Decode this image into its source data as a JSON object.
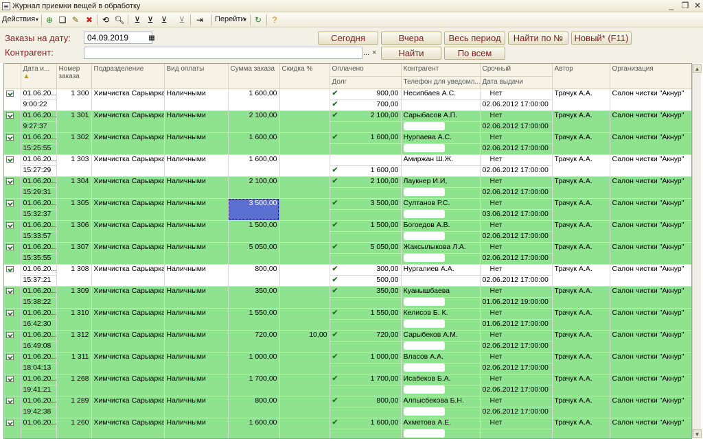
{
  "window": {
    "title": "Журнал приемки вещей в обработку"
  },
  "toolbar": {
    "actions": "Действия",
    "goto": "Перейти"
  },
  "form": {
    "date_label": "Заказы на дату:",
    "date_value": "04.09.2019",
    "contractor_label": "Контрагент:",
    "contractor_value": "",
    "btn_today": "Сегодня",
    "btn_yesterday": "Вчера",
    "btn_all_period": "Весь период",
    "btn_find_no": "Найти по №",
    "btn_new": "Новый* (F11)",
    "btn_find": "Найти",
    "btn_all": "По всем",
    "ellipsis": "...",
    "clear": "×"
  },
  "headers": {
    "date": "Дата и...",
    "number": "Номер заказа",
    "division": "Подразделение",
    "payment": "Вид оплаты",
    "sum": "Сумма заказа",
    "discount": "Скидка %",
    "paid": "Оплачено",
    "debt": "Долг",
    "contractor": "Контрагент",
    "phone": "Телефон для уведомл...",
    "urgent": "Срочный",
    "issue_date": "Дата выдачи",
    "author": "Автор",
    "org": "Организация"
  },
  "rows": [
    {
      "d1": "01.06.20...",
      "d2": "9:00:22",
      "no": "1 300",
      "div": "Химчистка Сарыарка",
      "pay": "Наличными",
      "sum": "1 600,00",
      "disc": "",
      "paid": "900,00",
      "debt": "700,00",
      "cnt": "Несипбаев А.С.",
      "ph": "",
      "urg": "Нет",
      "iss": "02.06.2012 17:00:00",
      "auth": "Трачук А.А.",
      "org": "Салон чистки \"Акнур\"",
      "color": "w",
      "debtcheck": true
    },
    {
      "d1": "01.06.20...",
      "d2": "9:27:37",
      "no": "1 301",
      "div": "Химчистка Сарыарка",
      "pay": "Наличными",
      "sum": "2 100,00",
      "disc": "",
      "paid": "2 100,00",
      "debt": "",
      "cnt": "Сарыбасов А.П.",
      "ph": "",
      "urg": "Нет",
      "iss": "02.06.2012 17:00:00",
      "auth": "Трачук А.А.",
      "org": "Салон чистки \"Акнур\"",
      "color": "g"
    },
    {
      "d1": "01.06.20...",
      "d2": "15:25:55",
      "no": "1 302",
      "div": "Химчистка Сарыарка",
      "pay": "Наличными",
      "sum": "1 600,00",
      "disc": "",
      "paid": "1 600,00",
      "debt": "",
      "cnt": "Нурпаева А.С.",
      "ph": "",
      "urg": "Нет",
      "iss": "02.06.2012 17:00:00",
      "auth": "Трачук А.А.",
      "org": "Салон чистки \"Акнур\"",
      "color": "g"
    },
    {
      "d1": "01.06.20...",
      "d2": "15:27:29",
      "no": "1 303",
      "div": "Химчистка Сарыарка",
      "pay": "Наличными",
      "sum": "1 600,00",
      "disc": "",
      "paid": "",
      "debt": "1 600,00",
      "cnt": "Амиржан Ш.Ж.",
      "ph": "",
      "urg": "Нет",
      "iss": "02.06.2012 17:00:00",
      "auth": "Трачук А.А.",
      "org": "Салон чистки \"Акнур\"",
      "color": "w",
      "debtcheck": true,
      "nopaidcheck": true
    },
    {
      "d1": "01.06.20...",
      "d2": "15:29:31",
      "no": "1 304",
      "div": "Химчистка Сарыарка",
      "pay": "Наличными",
      "sum": "2 100,00",
      "disc": "",
      "paid": "2 100,00",
      "debt": "",
      "cnt": "Лаукнер И.И,",
      "ph": "",
      "urg": "Нет",
      "iss": "02.06.2012 17:00:00",
      "auth": "Трачук А.А.",
      "org": "Салон чистки \"Акнур\"",
      "color": "g"
    },
    {
      "d1": "01.06.20...",
      "d2": "15:32:37",
      "no": "1 305",
      "div": "Химчистка Сарыарка",
      "pay": "Наличными",
      "sum": "3 500,00",
      "disc": "",
      "paid": "3 500,00",
      "debt": "",
      "cnt": "Султанов Р.С.",
      "ph": "",
      "urg": "Нет",
      "iss": "03.06.2012 17:00:00",
      "auth": "Трачук А.А.",
      "org": "Салон чистки \"Акнур\"",
      "color": "g",
      "selected": true
    },
    {
      "d1": "01.06.20...",
      "d2": "15:33:57",
      "no": "1 306",
      "div": "Химчистка Сарыарка",
      "pay": "Наличными",
      "sum": "1 500,00",
      "disc": "",
      "paid": "1 500,00",
      "debt": "",
      "cnt": "Богоедов А.В.",
      "ph": "",
      "urg": "Нет",
      "iss": "02.06.2012 17:00:00",
      "auth": "Трачук А.А.",
      "org": "Салон чистки \"Акнур\"",
      "color": "g"
    },
    {
      "d1": "01.06.20...",
      "d2": "15:35:55",
      "no": "1 307",
      "div": "Химчистка Сарыарка",
      "pay": "Наличными",
      "sum": "5 050,00",
      "disc": "",
      "paid": "5 050,00",
      "debt": "",
      "cnt": "Жаксылыкова Л.А.",
      "ph": "",
      "urg": "Нет",
      "iss": "02.06.2012 17:00:00",
      "auth": "Трачук А.А.",
      "org": "Салон чистки \"Акнур\"",
      "color": "g"
    },
    {
      "d1": "01.06.20...",
      "d2": "15:37:21",
      "no": "1 308",
      "div": "Химчистка Сарыарка",
      "pay": "Наличными",
      "sum": "800,00",
      "disc": "",
      "paid": "300,00",
      "debt": "500,00",
      "cnt": "Нургалиев А.А.",
      "ph": "",
      "urg": "Нет",
      "iss": "02.06.2012 17:00:00",
      "auth": "Трачук А.А.",
      "org": "Салон чистки \"Акнур\"",
      "color": "w",
      "debtcheck": true
    },
    {
      "d1": "01.06.20...",
      "d2": "15:38:22",
      "no": "1 309",
      "div": "Химчистка Сарыарка",
      "pay": "Наличными",
      "sum": "350,00",
      "disc": "",
      "paid": "350,00",
      "debt": "",
      "cnt": "Куанышбаева",
      "ph": "",
      "urg": "Нет",
      "iss": "01.06.2012 19:00:00",
      "auth": "Трачук А.А.",
      "org": "Салон чистки \"Акнур\"",
      "color": "g"
    },
    {
      "d1": "01.06.20...",
      "d2": "16:42:30",
      "no": "1 310",
      "div": "Химчистка Сарыарка",
      "pay": "Наличными",
      "sum": "1 550,00",
      "disc": "",
      "paid": "1 550,00",
      "debt": "",
      "cnt": "Келисов Б. К.",
      "ph": "",
      "urg": "Нет",
      "iss": "01.06.2012 17:00:00",
      "auth": "Трачук А.А.",
      "org": "Салон чистки \"Акнур\"",
      "color": "g"
    },
    {
      "d1": "01.06.20...",
      "d2": "16:49:08",
      "no": "1 312",
      "div": "Химчистка Сарыарка",
      "pay": "Наличными",
      "sum": "720,00",
      "disc": "10,00",
      "paid": "720,00",
      "debt": "",
      "cnt": "Сарыбеков А.М.",
      "ph": "",
      "urg": "Нет",
      "iss": "02.06.2012 17:00:00",
      "auth": "Трачук А.А.",
      "org": "Салон чистки \"Акнур\"",
      "color": "g"
    },
    {
      "d1": "01.06.20...",
      "d2": "18:04:13",
      "no": "1 311",
      "div": "Химчистка Сарыарка",
      "pay": "Наличными",
      "sum": "1 000,00",
      "disc": "",
      "paid": "1 000,00",
      "debt": "",
      "cnt": "Власов А.А.",
      "ph": "",
      "urg": "Нет",
      "iss": "02.06.2012 17:00:00",
      "auth": "Трачук А.А.",
      "org": "Салон чистки \"Акнур\"",
      "color": "g"
    },
    {
      "d1": "01.06.20...",
      "d2": "19:41:21",
      "no": "1 268",
      "div": "Химчистка Сарыарка",
      "pay": "Наличными",
      "sum": "1 700,00",
      "disc": "",
      "paid": "1 700,00",
      "debt": "",
      "cnt": "Исабеков Б.А.",
      "ph": "",
      "urg": "Нет",
      "iss": "02.06.2012 17:00:00",
      "auth": "Трачук А.А.",
      "org": "Салон чистки \"Акнур\"",
      "color": "g"
    },
    {
      "d1": "01.06.20...",
      "d2": "19:42:38",
      "no": "1 289",
      "div": "Химчистка Сарыарка",
      "pay": "Наличными",
      "sum": "800,00",
      "disc": "",
      "paid": "800,00",
      "debt": "",
      "cnt": "Алпысбекова Б.Н.",
      "ph": "",
      "urg": "Нет",
      "iss": "02.06.2012 17:00:00",
      "auth": "Трачук А.А.",
      "org": "Салон чистки \"Акнур\"",
      "color": "g"
    },
    {
      "d1": "01.06.20...",
      "d2": "",
      "no": "1 260",
      "div": "Химчистка Сарыарка",
      "pay": "Наличными",
      "sum": "1 600,00",
      "disc": "",
      "paid": "1 600,00",
      "debt": "",
      "cnt": "Ахметова А.Е.",
      "ph": "",
      "urg": "Нет",
      "iss": "",
      "auth": "Трачук А.А.",
      "org": "Салон чистки \"Акнур\"",
      "color": "g"
    }
  ]
}
